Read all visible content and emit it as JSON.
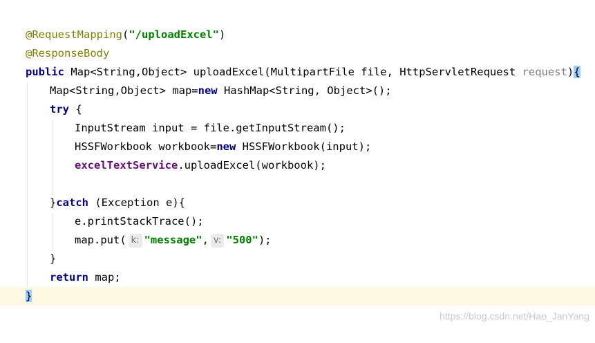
{
  "editor": {
    "lines": {
      "l1": {
        "annotation": "@RequestMapping",
        "paren_open": "(",
        "string": "\"/uploadExcel\"",
        "paren_close": ")"
      },
      "l2": {
        "annotation": "@ResponseBody"
      },
      "l3": {
        "kw_public": "public",
        "sig": " Map<String,Object> uploadExcel(MultipartFile file, HttpServletRequest ",
        "unused_param": "request",
        "paren_close": ")",
        "brace": "{"
      },
      "l4": {
        "text_a": "Map<String,Object> map=",
        "kw_new": "new",
        "text_b": " HashMap<String, Object>();"
      },
      "l5": {
        "kw_try": "try",
        "text": " {"
      },
      "l6": {
        "text": "InputStream input = file.getInputStream();"
      },
      "l7": {
        "text_a": "HSSFWorkbook workbook=",
        "kw_new": "new",
        "text_b": " HSSFWorkbook(input);"
      },
      "l8": {
        "field": "excelTextService",
        "text": ".uploadExcel(workbook);"
      },
      "l10": {
        "brace": "}",
        "kw_catch": "catch",
        "text": " (Exception e){"
      },
      "l11": {
        "text": "e.printStackTrace();"
      },
      "l12": {
        "text_a": "map.put(",
        "hint_k": "k:",
        "str_k": "\"message\"",
        "comma": ",",
        "hint_v": "v:",
        "str_v": "\"500\"",
        "text_b": ");"
      },
      "l13": {
        "brace": "}"
      },
      "l14": {
        "kw_return": "return",
        "text": " map;"
      },
      "l15": {
        "brace": "}"
      }
    },
    "colors": {
      "annotation": "#808000",
      "keyword": "#000080",
      "string": "#008000",
      "field": "#660e7a",
      "unused": "#808080",
      "caret_line": "#fdf9e3",
      "brace_match": "#99ccff"
    }
  },
  "watermark": {
    "text": "https://blog.csdn.net/Hao_JanYang"
  }
}
